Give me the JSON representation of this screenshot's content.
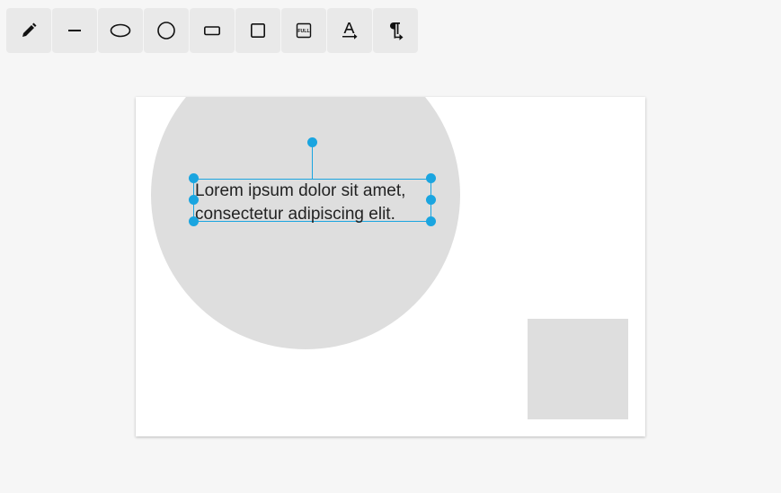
{
  "toolbar": {
    "tools": [
      {
        "id": "pencil",
        "icon": "pencil-icon"
      },
      {
        "id": "line",
        "icon": "line-icon"
      },
      {
        "id": "ellipse",
        "icon": "ellipse-icon"
      },
      {
        "id": "circle",
        "icon": "circle-icon"
      },
      {
        "id": "rectangle",
        "icon": "rectangle-icon"
      },
      {
        "id": "square",
        "icon": "square-icon"
      },
      {
        "id": "fill",
        "icon": "fill-icon",
        "label": "FULL"
      },
      {
        "id": "text",
        "icon": "text-icon"
      },
      {
        "id": "paragraph",
        "icon": "paragraph-icon"
      }
    ]
  },
  "canvas": {
    "text_box": {
      "line1": "Lorem ipsum dolor sit amet,",
      "line2": "consectetur adipiscing elit."
    }
  },
  "colors": {
    "accent": "#1aa5e0",
    "shape_fill": "#dedede",
    "toolbar_button": "#e9e9e9",
    "background": "#f6f6f6"
  }
}
